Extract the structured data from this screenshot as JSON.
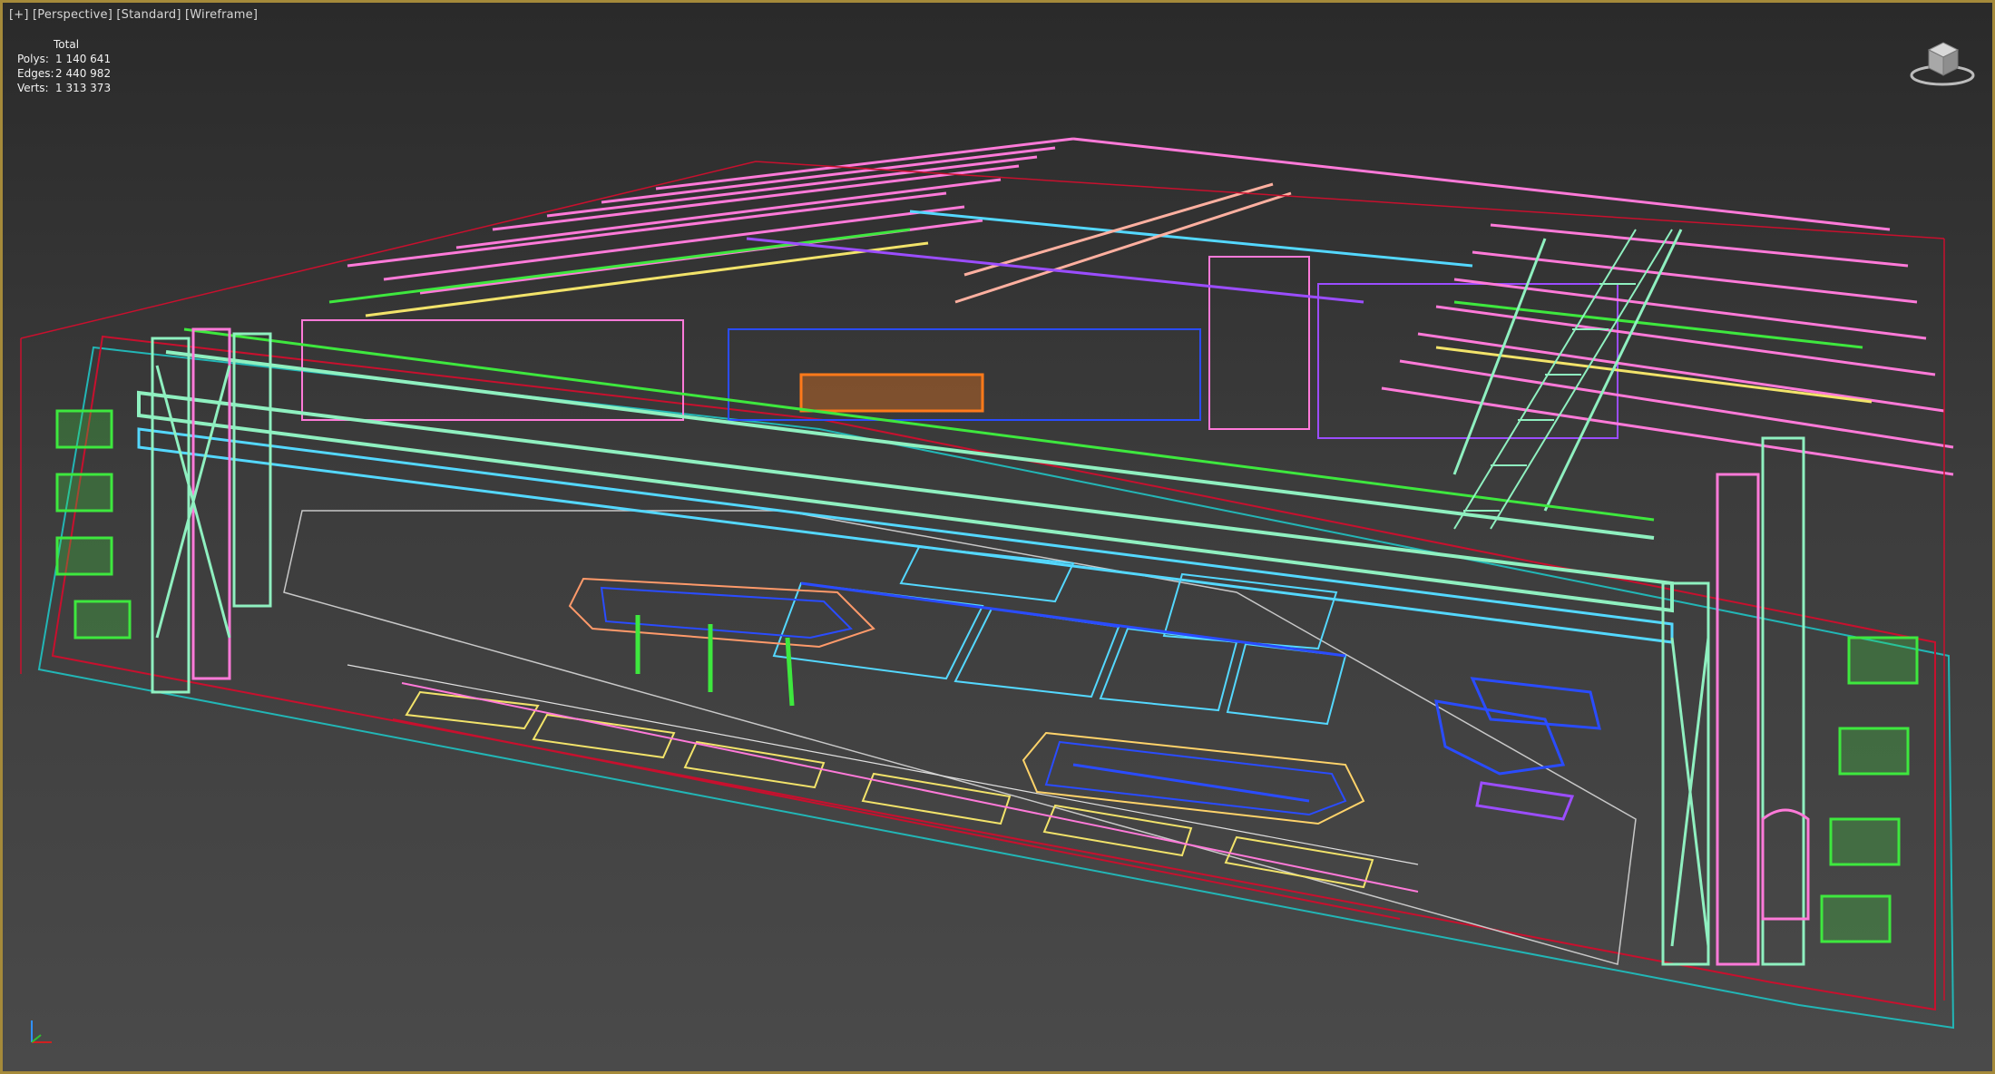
{
  "viewport": {
    "label_plus": "[+]",
    "label_view": "[Perspective]",
    "label_shading": "[Standard]",
    "label_mode": "[Wireframe]",
    "border_color": "#a58a3a"
  },
  "stats": {
    "header": "Total",
    "polys_label": "Polys:",
    "polys_value": "1 140 641",
    "edges_label": "Edges:",
    "edges_value": "2 440 982",
    "verts_label": "Verts:",
    "verts_value": "1 313 373"
  },
  "icons": {
    "viewcube": "viewcube-icon",
    "axis_tripod": "axis-tripod-icon"
  },
  "wire_colors": {
    "mint": "#8ff0c0",
    "pink": "#ff7ad9",
    "violet": "#9b4dff",
    "cyan": "#54d8ff",
    "blue": "#2a4cff",
    "green": "#3ee83e",
    "orange": "#ff7a1a",
    "yellow": "#f2e36a",
    "red": "#c8102e",
    "teal": "#22b6b6"
  }
}
